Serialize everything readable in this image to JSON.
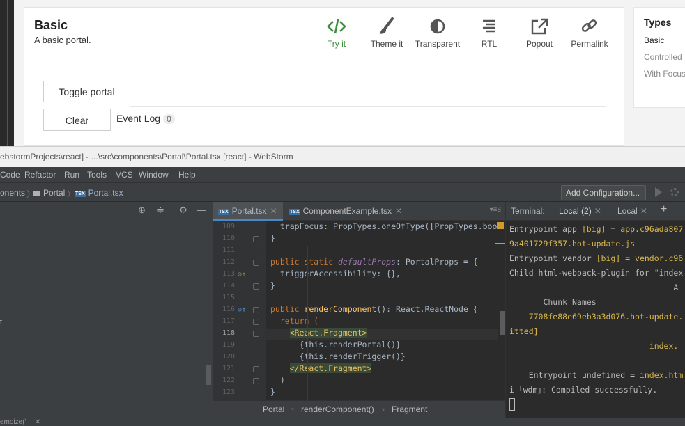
{
  "portal_card": {
    "title": "Basic",
    "subtitle": "A basic portal.",
    "actions": [
      {
        "label": "Try it",
        "icon": "code-icon"
      },
      {
        "label": "Theme it",
        "icon": "brush-icon"
      },
      {
        "label": "Transparent",
        "icon": "contrast-icon"
      },
      {
        "label": "RTL",
        "icon": "align-right-icon"
      },
      {
        "label": "Popout",
        "icon": "external-link-icon"
      },
      {
        "label": "Permalink",
        "icon": "link-icon"
      }
    ],
    "toggle_button": "Toggle portal",
    "clear_button": "Clear",
    "event_log_label": "Event Log",
    "event_log_count": "0"
  },
  "types_panel": {
    "title": "Types",
    "items": [
      "Basic",
      "Controlled",
      "With Focus"
    ]
  },
  "window_title": "ebstormProjects\\react] - ...\\src\\components\\Portal\\Portal.tsx [react] - WebStorm",
  "menu": [
    "Code",
    "Refactor",
    "Run",
    "Tools",
    "VCS",
    "Window",
    "Help"
  ],
  "nav": {
    "crumbs": [
      "onents",
      "Portal",
      "Portal.tsx"
    ],
    "add_configuration": "Add Configuration..."
  },
  "project_tree": {
    "partial_item": "t"
  },
  "editor": {
    "tabs": [
      {
        "label": "Portal.tsx",
        "active": true
      },
      {
        "label": "ComponentExample.tsx",
        "active": false
      }
    ],
    "tab_count": "8",
    "line_numbers": [
      "109",
      "110",
      "111",
      "112",
      "113",
      "114",
      "115",
      "116",
      "117",
      "118",
      "119",
      "120",
      "121",
      "122",
      "123"
    ],
    "current_line": "118",
    "lines": [
      "  trapFocus: PropTypes.oneOfType([PropTypes.bool",
      "}",
      "",
      "public static defaultProps: PortalProps = {",
      "  triggerAccessibility: {},",
      "}",
      "",
      "public renderComponent(): React.ReactNode {",
      "  return (",
      "    <React.Fragment>",
      "      {this.renderPortal()}",
      "      {this.renderTrigger()}",
      "    </React.Fragment>",
      "  )",
      "}"
    ],
    "breadcrumb": [
      "Portal",
      "renderComponent()",
      "Fragment"
    ]
  },
  "terminal": {
    "label": "Terminal:",
    "tabs": [
      "Local (2)",
      "Local"
    ],
    "lines": [
      "Entrypoint app [big] = app.c96ada807",
      "9a401729f357.hot-update.js",
      "Entrypoint vendor [big] = vendor.c96",
      "Child html-webpack-plugin for \"index",
      "                                  A",
      "       Chunk Names",
      "    7708fe88e69eb3a3d076.hot-update.",
      "itted]",
      "                             index.",
      "",
      "    Entrypoint undefined = index.htm",
      "i ｢wdm｣: Compiled successfully."
    ]
  },
  "status_bar": {
    "text": "emoize('"
  }
}
